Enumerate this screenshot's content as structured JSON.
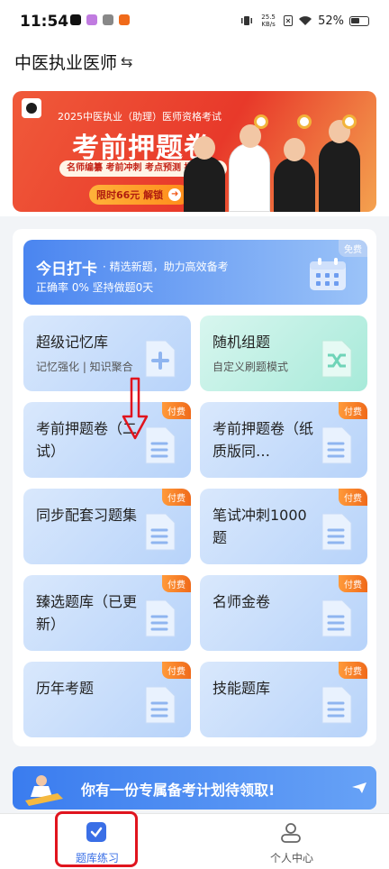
{
  "status_bar": {
    "time": "11:54",
    "net_speed_value": "25.5",
    "net_speed_unit": "KB/s",
    "battery": "52%"
  },
  "header": {
    "title": "中医执业医师",
    "swap_icon": "swap-icon"
  },
  "banner": {
    "subtitle": "2025中医执业（助理）医师资格考试",
    "title": "考前押题卷",
    "tagline": "名师编纂 考前冲刺 考点预测 提升突击",
    "cta_text": "限时66元 解锁"
  },
  "checkin": {
    "title": "今日打卡",
    "subtitle": "· 精选新题，助力高效备考",
    "stats": "正确率 0% 坚持做题0天",
    "badge": "免费",
    "icon": "calendar-icon"
  },
  "tiles": [
    {
      "title": "超级记忆库",
      "sub": "记忆强化 | 知识聚合",
      "badge": "",
      "icon": "plus-doc-icon",
      "color": "blue"
    },
    {
      "title": "随机组题",
      "sub": "自定义刷题模式",
      "badge": "",
      "icon": "shuffle-doc-icon",
      "color": "green"
    },
    {
      "title": "考前押题卷（二试）",
      "sub": "",
      "badge": "付费",
      "icon": "doc-icon",
      "color": "blue"
    },
    {
      "title": "考前押题卷（纸质版同…",
      "sub": "",
      "badge": "付费",
      "icon": "doc-icon",
      "color": "blue"
    },
    {
      "title": "同步配套习题集",
      "sub": "",
      "badge": "付费",
      "icon": "doc-icon",
      "color": "blue"
    },
    {
      "title": "笔试冲刺1000题",
      "sub": "",
      "badge": "付费",
      "icon": "doc-icon",
      "color": "blue"
    },
    {
      "title": "臻选题库（已更新）",
      "sub": "",
      "badge": "付费",
      "icon": "doc-icon",
      "color": "blue"
    },
    {
      "title": "名师金卷",
      "sub": "",
      "badge": "付费",
      "icon": "doc-icon",
      "color": "blue"
    },
    {
      "title": "历年考题",
      "sub": "",
      "badge": "付费",
      "icon": "doc-icon",
      "color": "blue"
    },
    {
      "title": "技能题库",
      "sub": "",
      "badge": "付费",
      "icon": "doc-icon",
      "color": "blue"
    }
  ],
  "bottom_banner": {
    "text": "你有一份专属备考计划待领取!"
  },
  "tabbar": {
    "items": [
      {
        "label": "题库练习",
        "icon": "question-bank-icon",
        "active": true
      },
      {
        "label": "个人中心",
        "icon": "person-icon",
        "active": false
      }
    ]
  },
  "colors": {
    "accent": "#3a6fe6",
    "paid_badge": "#f06a1a",
    "annotation_red": "#e0141e"
  }
}
